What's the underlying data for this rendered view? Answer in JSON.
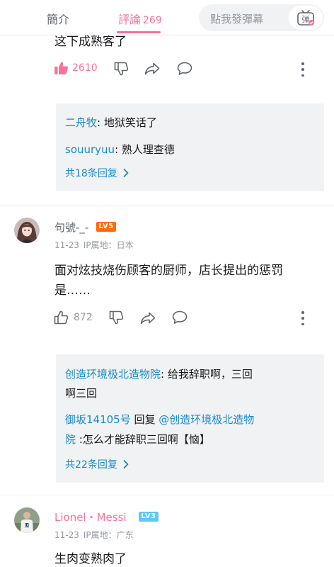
{
  "tabs": {
    "intro": "簡介",
    "comments": "評論",
    "comment_count": "269"
  },
  "danmaku": {
    "placeholder": "點我發彈幕",
    "button_glyph": "弹"
  },
  "comment1": {
    "text": "这下成熟客了",
    "like_count": "2610",
    "liked": true,
    "replies": [
      {
        "name": "二舟牧",
        "text": ": 地狱笑话了"
      },
      {
        "name": "souuryuu",
        "text": ": 熟人理查德"
      }
    ],
    "more": "共18条回复"
  },
  "comment2": {
    "username": "句號-_-",
    "level": "LV5",
    "date": "11-23",
    "ip": "IP属地：日本",
    "text_line1": "面对炫技烧伤顾客的厨师，店长提出的惩罚",
    "text_line2": "是……",
    "like_count": "872",
    "reply1": {
      "name": "创造环境极北造物院",
      "text": ": 给我辞职啊，三回",
      "line2": "啊三回"
    },
    "reply2": {
      "name": "御坂14105号",
      "reply_word": " 回复 ",
      "mention": "@创造环境极北造物",
      "mention_line2": "院",
      "text": " :怎么才能辞职三回啊【恼】"
    },
    "more": "共22条回复"
  },
  "comment3": {
    "username": "Lionel・Messi",
    "level": "LV3",
    "date": "11-23",
    "ip": "IP属地：广东",
    "text": "生肉变熟肉了"
  },
  "colors": {
    "accent": "#fb7299",
    "link": "#178bcf",
    "lv5": "#ff6c00",
    "lv3": "#5ec9fa"
  }
}
